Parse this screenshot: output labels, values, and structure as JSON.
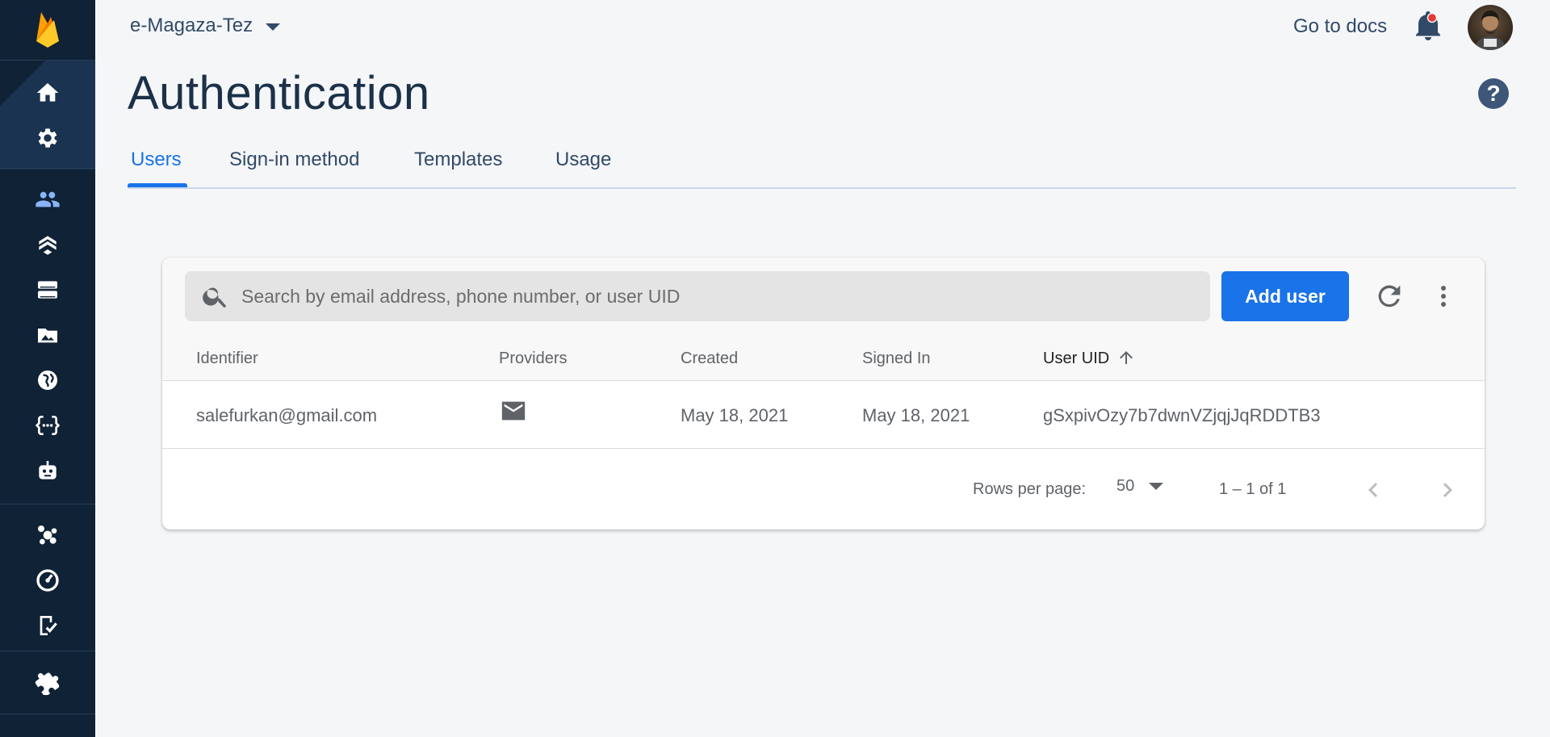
{
  "header": {
    "project_name": "e-Magaza-Tez",
    "docs_link": "Go to docs",
    "page_title": "Authentication",
    "help_glyph": "?"
  },
  "tabs": [
    {
      "label": "Users",
      "active": true
    },
    {
      "label": "Sign-in method",
      "active": false
    },
    {
      "label": "Templates",
      "active": false
    },
    {
      "label": "Usage",
      "active": false
    }
  ],
  "sidebar": {
    "icons": [
      "home-icon",
      "settings-icon",
      "authentication-icon",
      "firestore-icon",
      "realtime-database-icon",
      "storage-icon",
      "hosting-icon",
      "functions-icon",
      "ml-icon",
      "crashlytics-icon",
      "performance-icon",
      "test-lab-icon",
      "extensions-icon"
    ]
  },
  "users_table": {
    "search_placeholder": "Search by email address, phone number, or user UID",
    "add_user_label": "Add user",
    "columns": [
      "Identifier",
      "Providers",
      "Created",
      "Signed In",
      "User UID"
    ],
    "sorted_column": "User UID",
    "sort_direction": "ascending",
    "rows": [
      {
        "identifier": "salefurkan@gmail.com",
        "provider": "email-icon",
        "created": "May 18, 2021",
        "signed_in": "May 18, 2021",
        "uid": "gSxpivOzy7b7dwnVZjqjJqRDDTB3"
      }
    ],
    "rows_per_page_label": "Rows per page:",
    "rows_per_page_value": "50",
    "range_label": "1 – 1 of 1"
  },
  "colors": {
    "sidebar": "#0f2236",
    "accent": "#1a73e8",
    "title": "#1b3149",
    "page_bg": "#f5f6f8"
  }
}
